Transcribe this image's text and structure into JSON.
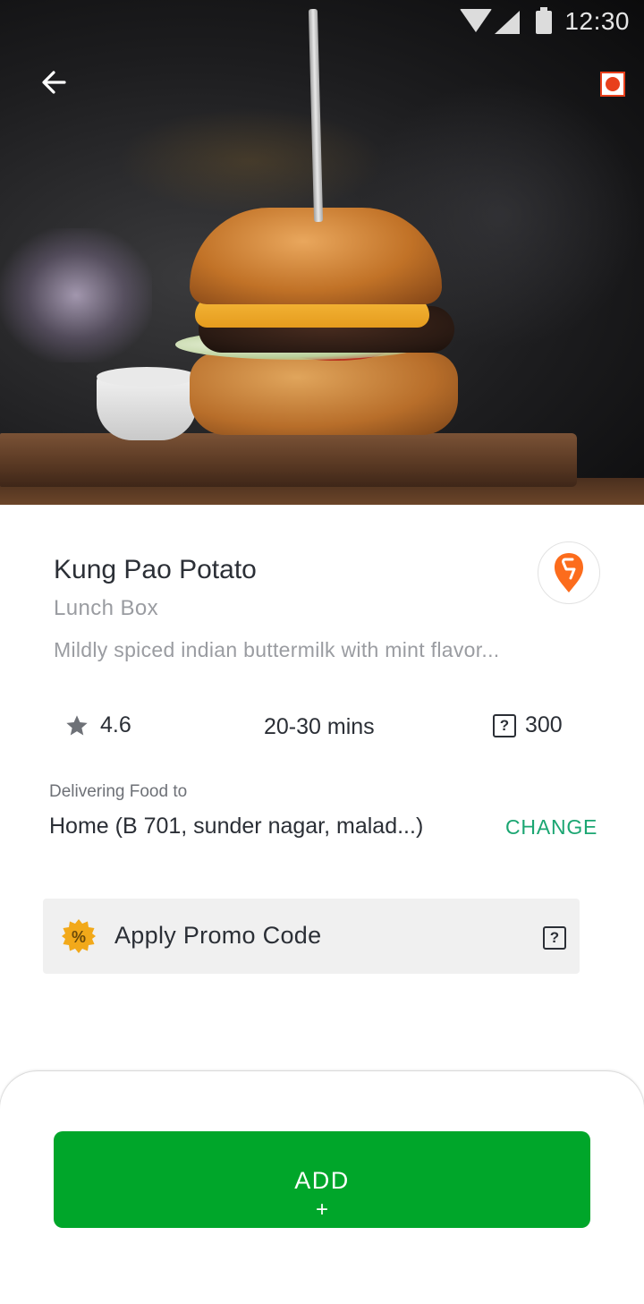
{
  "status_bar": {
    "time": "12:30"
  },
  "product": {
    "name": "Kung Pao Potato",
    "restaurant": "Lunch Box",
    "description": "Mildly spiced indian buttermilk with mint flavor..."
  },
  "stats": {
    "rating": "4.6",
    "delivery_time": "20-30 mins",
    "price": "300",
    "price_symbol": "?"
  },
  "delivery": {
    "label": "Delivering Food to",
    "address": "Home (B 701, sunder nagar, malad...)",
    "change_label": "CHANGE"
  },
  "promo": {
    "label": "Apply Promo Code",
    "help_symbol": "?"
  },
  "cta": {
    "label": "ADD",
    "icon": "+"
  },
  "colors": {
    "primary_green": "#00a62a",
    "change_green": "#1ba672",
    "brand_orange": "#fc6c1c",
    "record_red": "#e8401c",
    "promo_badge": "#f2a91a"
  },
  "icons": [
    "back-arrow-icon",
    "record-icon",
    "brand-logo-icon",
    "star-icon",
    "price-icon",
    "percent-badge-icon",
    "help-icon",
    "plus-icon",
    "wifi-icon",
    "cellular-icon",
    "battery-icon"
  ]
}
